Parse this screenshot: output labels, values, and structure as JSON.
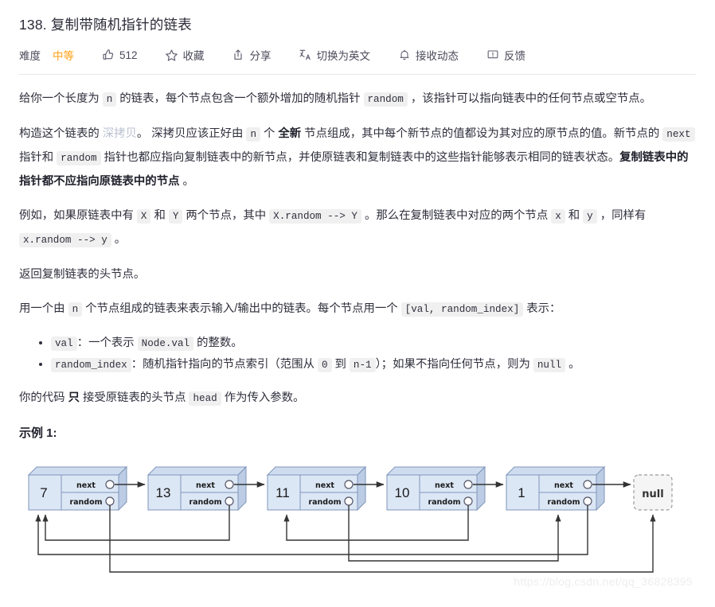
{
  "header": {
    "title": "138. 复制带随机指针的链表",
    "difficulty_label": "难度",
    "difficulty_value": "中等",
    "actions": [
      {
        "icon": "thumbs-up-icon",
        "label": "512"
      },
      {
        "icon": "star-icon",
        "label": "收藏"
      },
      {
        "icon": "share-icon",
        "label": "分享"
      },
      {
        "icon": "translate-icon",
        "label": "切换为英文"
      },
      {
        "icon": "bell-icon",
        "label": "接收动态"
      },
      {
        "icon": "feedback-icon",
        "label": "反馈"
      }
    ]
  },
  "content": {
    "p1": {
      "a": "给你一个长度为 ",
      "code1": "n",
      "b": " 的链表，每个节点包含一个额外增加的随机指针 ",
      "code2": "random",
      "c": " ，该指针可以指向链表中的任何节点或空节点。"
    },
    "p2": {
      "a": "构造这个链表的 ",
      "link": "深拷贝",
      "b": "。 深拷贝应该正好由 ",
      "code1": "n",
      "c": " 个 ",
      "bold1": "全新",
      "d": " 节点组成，其中每个新节点的值都设为其对应的原节点的值。新节点的 ",
      "code2": "next",
      "e": " 指针和 ",
      "code3": "random",
      "f": " 指针也都应指向复制链表中的新节点，并使原链表和复制链表中的这些指针能够表示相同的链表状态。",
      "bold2": "复制链表中的指针都不应指向原链表中的节点",
      "g": " 。"
    },
    "p3": {
      "a": "例如，如果原链表中有 ",
      "code1": "X",
      "b": " 和 ",
      "code2": "Y",
      "c": " 两个节点，其中 ",
      "code3": "X.random --> Y",
      "d": " 。那么在复制链表中对应的两个节点 ",
      "code4": "x",
      "e": " 和 ",
      "code5": "y",
      "f": " ，同样有 ",
      "code6": "x.random --> y",
      "g": " 。"
    },
    "p4": "返回复制链表的头节点。",
    "p5": {
      "a": "用一个由 ",
      "code1": "n",
      "b": " 个节点组成的链表来表示输入/输出中的链表。每个节点用一个 ",
      "code2": "[val, random_index]",
      "c": " 表示："
    },
    "bullet1": {
      "code1": "val",
      "a": "：一个表示 ",
      "code2": "Node.val",
      "b": " 的整数。"
    },
    "bullet2": {
      "code1": "random_index",
      "a": "：随机指针指向的节点索引（范围从 ",
      "code2": "0",
      "b": " 到 ",
      "code3": "n-1",
      "c": "）；如果不指向任何节点，则为 ",
      "code4": "null",
      "d": " 。"
    },
    "p6": {
      "a": "你的代码 ",
      "bold": "只",
      "b": " 接受原链表的头节点 ",
      "code1": "head",
      "c": " 作为传入参数。"
    },
    "example_title": "示例 1:"
  },
  "diagram": {
    "type": "linked-list-with-random-pointers",
    "next_field_label": "next",
    "random_field_label": "random",
    "null_label": "null",
    "nodes": [
      {
        "index": 0,
        "val": "7",
        "random_index": null
      },
      {
        "index": 1,
        "val": "13",
        "random_index": 0
      },
      {
        "index": 2,
        "val": "11",
        "random_index": 4
      },
      {
        "index": 3,
        "val": "10",
        "random_index": 2
      },
      {
        "index": 4,
        "val": "1",
        "random_index": 0
      }
    ],
    "colors": {
      "node_fill": "#cfdcef",
      "node_body_fill": "#dce7f5",
      "node_stroke": "#7f96bb",
      "null_fill": "#f5f5f5",
      "null_stroke": "#999999",
      "arrow": "#333333"
    }
  },
  "watermark": "https://blog.csdn.net/qq_36828395"
}
